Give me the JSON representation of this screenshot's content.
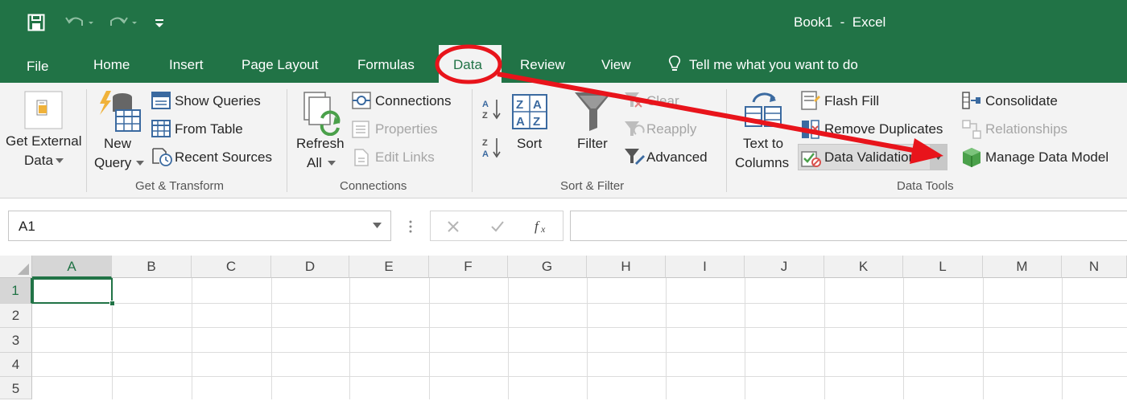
{
  "window": {
    "title": "Book1  -  Excel"
  },
  "tabs": [
    {
      "label": "File"
    },
    {
      "label": "Home"
    },
    {
      "label": "Insert"
    },
    {
      "label": "Page Layout"
    },
    {
      "label": "Formulas"
    },
    {
      "label": "Data",
      "active": true
    },
    {
      "label": "Review"
    },
    {
      "label": "View"
    }
  ],
  "tell_me": "Tell me what you want to do",
  "ribbon": {
    "get_external_data": [
      "Get External",
      "Data"
    ],
    "new_query": [
      "New",
      "Query"
    ],
    "show_queries": "Show Queries",
    "from_table": "From Table",
    "recent_sources": "Recent Sources",
    "group_get_transform": "Get & Transform",
    "refresh_all": [
      "Refresh",
      "All"
    ],
    "connections": "Connections",
    "properties": "Properties",
    "edit_links": "Edit Links",
    "group_connections": "Connections",
    "sort": "Sort",
    "filter": "Filter",
    "clear": "Clear",
    "reapply": "Reapply",
    "advanced": "Advanced",
    "group_sort_filter": "Sort & Filter",
    "text_to_columns": [
      "Text to",
      "Columns"
    ],
    "flash_fill": "Flash Fill",
    "remove_duplicates": "Remove Duplicates",
    "data_validation": "Data Validation",
    "consolidate": "Consolidate",
    "relationships": "Relationships",
    "manage_data_model": "Manage Data Model",
    "group_data_tools": "Data Tools"
  },
  "formula_bar": {
    "name_box": "A1",
    "formula": ""
  },
  "columns": [
    "A",
    "B",
    "C",
    "D",
    "E",
    "F",
    "G",
    "H",
    "I",
    "J",
    "K",
    "L",
    "M",
    "N"
  ],
  "rows": [
    "1",
    "2",
    "3",
    "4",
    "5"
  ],
  "colors": {
    "excel_green": "#217346",
    "annotation_red": "#e8141b"
  }
}
